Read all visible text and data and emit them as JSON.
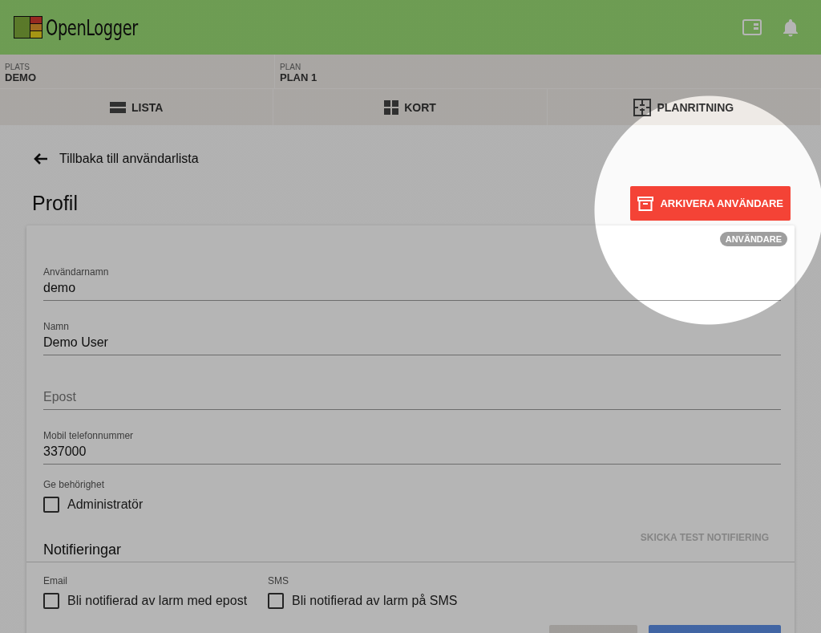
{
  "header": {
    "logo_text": "OpenLogger"
  },
  "context": [
    {
      "label": "PLATS",
      "value": "DEMO"
    },
    {
      "label": "PLAN",
      "value": "PLAN 1"
    }
  ],
  "views": [
    {
      "label": "LISTA"
    },
    {
      "label": "KORT"
    },
    {
      "label": "PLANRITNING"
    }
  ],
  "back_link": "Tillbaka till användarlista",
  "page_title": "Profil",
  "archive_button": "ARKIVERA ANVÄNDARE",
  "role_badge": "ANVÄNDARE",
  "fields": [
    {
      "label": "Användarnamn",
      "value": "demo"
    },
    {
      "label": "Namn",
      "value": "Demo User"
    },
    {
      "placeholder": "Epost"
    },
    {
      "label": "Mobil telefonnummer",
      "value": "337000"
    }
  ],
  "permissions": {
    "label": "Ge behörighet",
    "options": [
      {
        "label": "Administratör",
        "checked": false
      }
    ]
  },
  "notifications": {
    "title": "Notifieringar",
    "test_button": {
      "label": "SKICKA TEST NOTIFIERING",
      "disabled": true
    },
    "channels": [
      {
        "label": "Email",
        "option": "Bli notifierad av larm med epost",
        "checked": false
      },
      {
        "label": "SMS",
        "option": "Bli notifierad av larm på SMS",
        "checked": false
      }
    ]
  }
}
